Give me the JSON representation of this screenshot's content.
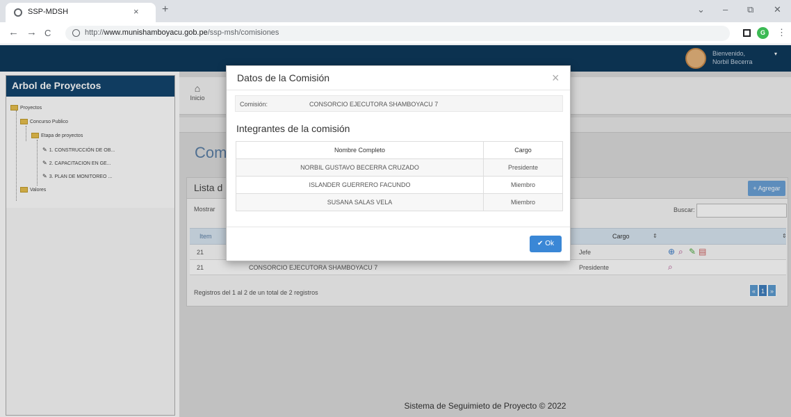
{
  "browser": {
    "tab_title": "SSP-MDSH",
    "tab_close": "×",
    "new_tab": "+",
    "url_prefix": "http://",
    "url_host": "www.munishamboyacu.gob.pe",
    "url_path": "/ssp-msh/comisiones",
    "profile_initial": "G",
    "minimize": "–",
    "restore": "⧉",
    "close": "✕",
    "dropdown": "⌄",
    "back": "←",
    "forward": "→",
    "reload": "C",
    "menu": "⋮"
  },
  "header": {
    "greeting": "Bienvenido,",
    "user_name": "Norbil Becerra",
    "caret": "▾"
  },
  "sidebar": {
    "title": "Arbol de Proyectos",
    "items": [
      {
        "label": "Proyectos"
      },
      {
        "label": "Concurso Publico"
      },
      {
        "label": "Etapa de proyectos"
      },
      {
        "label": "1. CONSTRUCCIÓN DE OB..."
      },
      {
        "label": "2. CAPACITACION EN GE..."
      },
      {
        "label": "3. PLAN DE MONITOREO ..."
      },
      {
        "label": "Valores"
      }
    ]
  },
  "module": {
    "home_label": "Inicio",
    "home_icon_glyph": "⌂"
  },
  "page": {
    "title": "Comi",
    "panel_title": "Lista d",
    "add_label": "+ Agregar",
    "show_label": "Mostrar",
    "search_label": "Buscar:",
    "columns": {
      "item": "Item",
      "cargo": "Cargo"
    },
    "rows": [
      {
        "item": "21",
        "name": "",
        "cargo": "Jefe"
      },
      {
        "item": "21",
        "name": "CONSORCIO EJECUTORA SHAMBOYACU 7",
        "cargo": "Presidente"
      }
    ],
    "pager_text": "Registros del 1 al 2 de un total de 2 registros",
    "pager": {
      "prev": "«",
      "current": "1",
      "next": "»"
    },
    "footer": "Sistema de Seguimieto de Proyecto © 2022"
  },
  "modal": {
    "title": "Datos de la Comisión",
    "close": "×",
    "commission_label": "Comisión:",
    "commission_value": "CONSORCIO EJECUTORA SHAMBOYACU 7",
    "members_title": "Integrantes de la comisión",
    "columns": {
      "name": "Nombre Completo",
      "cargo": "Cargo"
    },
    "members": [
      {
        "name": "NORBIL GUSTAVO BECERRA CRUZADO",
        "cargo": "Presidente"
      },
      {
        "name": "ISLANDER GUERRERO FACUNDO",
        "cargo": "Miembro"
      },
      {
        "name": "SUSANA SALAS VELA",
        "cargo": "Miembro"
      }
    ],
    "ok_label": "✔ Ok"
  },
  "colors": {
    "header": "#0e3a5c",
    "sidebar_title": "#13456e",
    "accent": "#3a87d6"
  }
}
